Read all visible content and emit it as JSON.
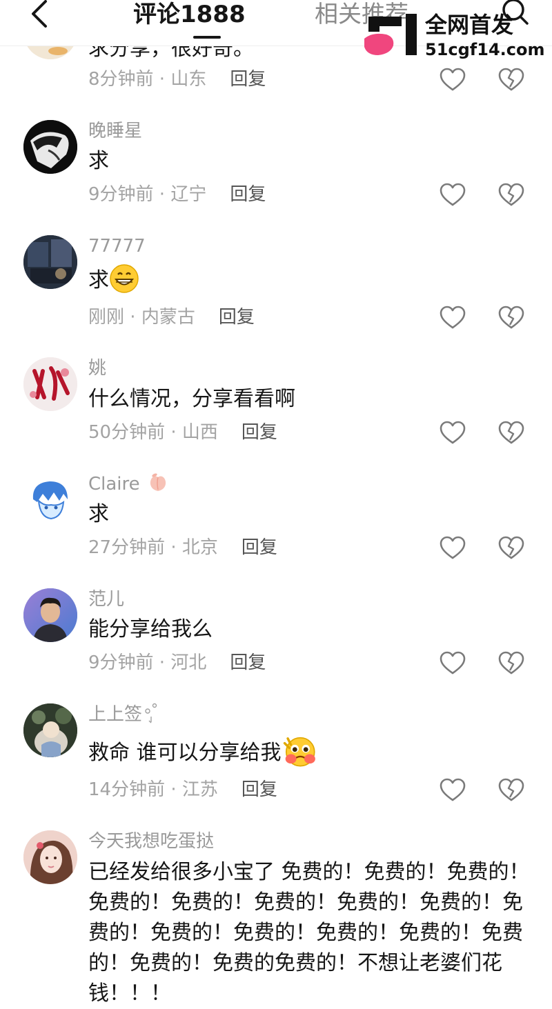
{
  "header": {
    "comments_tab": "评论1888",
    "related_tab": "相关推荐"
  },
  "watermark": {
    "title": "全网首发",
    "url": "51cgf14.com"
  },
  "colors": {
    "text_primary": "#161616",
    "text_secondary": "#9a9a9a",
    "watermark_pink": "#f0467e"
  },
  "comments": [
    {
      "username": "",
      "content": "求分享，很好奇。",
      "time": "8分钟前",
      "location": "山东",
      "reply_label": "回复"
    },
    {
      "username": "晚睡星",
      "content": "求",
      "time": "9分钟前",
      "location": "辽宁",
      "reply_label": "回复"
    },
    {
      "username": "77777",
      "content": "求",
      "emoji": "grinning-emoji",
      "time": "刚刚",
      "location": "内蒙古",
      "reply_label": "回复"
    },
    {
      "username": "姚",
      "content": "什么情况，分享看看啊",
      "time": "50分钟前",
      "location": "山西",
      "reply_label": "回复"
    },
    {
      "username": "Claire",
      "badge": "peach-icon",
      "content": "求",
      "time": "27分钟前",
      "location": "北京",
      "reply_label": "回复"
    },
    {
      "username": "范儿",
      "content": "能分享给我么",
      "time": "9分钟前",
      "location": "河北",
      "reply_label": "回复"
    },
    {
      "username": "上上签",
      "content": "救命 谁可以分享给我",
      "emoji": "pleading-emoji",
      "time": "14分钟前",
      "location": "江苏",
      "reply_label": "回复"
    },
    {
      "username": "今天我想吃蛋挞",
      "content": "已经发给很多小宝了 免费的！免费的！免费的！免费的！免费的！免费的！免费的！免费的！免费的！免费的！免费的！免费的！免费的！免费的！免费的！免费的免费的！不想让老婆们花钱！！！"
    }
  ]
}
